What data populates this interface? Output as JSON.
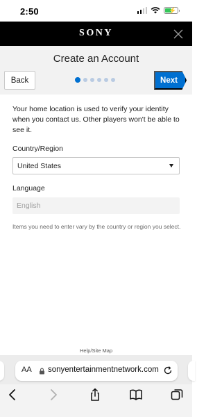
{
  "status": {
    "time": "2:50"
  },
  "brand": {
    "logo_text": "SONY"
  },
  "header": {
    "title": "Create an Account",
    "back_label": "Back",
    "next_label": "Next",
    "steps_total": 6,
    "steps_current": 1
  },
  "form": {
    "intro": "Your home location is used to verify your identity when you contact us. Other players won't be able to see it.",
    "country_label": "Country/Region",
    "country_value": "United States",
    "language_label": "Language",
    "language_value": "English",
    "note": "Items you need to enter vary by the country or region you select."
  },
  "footer": {
    "help_link": "Help/Site Map"
  },
  "browser": {
    "text_size_label": "AA",
    "url": "sonyentertainmentnetwork.com"
  },
  "colors": {
    "accent": "#0070d1",
    "brand_bar": "#000000",
    "header_bg": "#f2f2f2"
  }
}
